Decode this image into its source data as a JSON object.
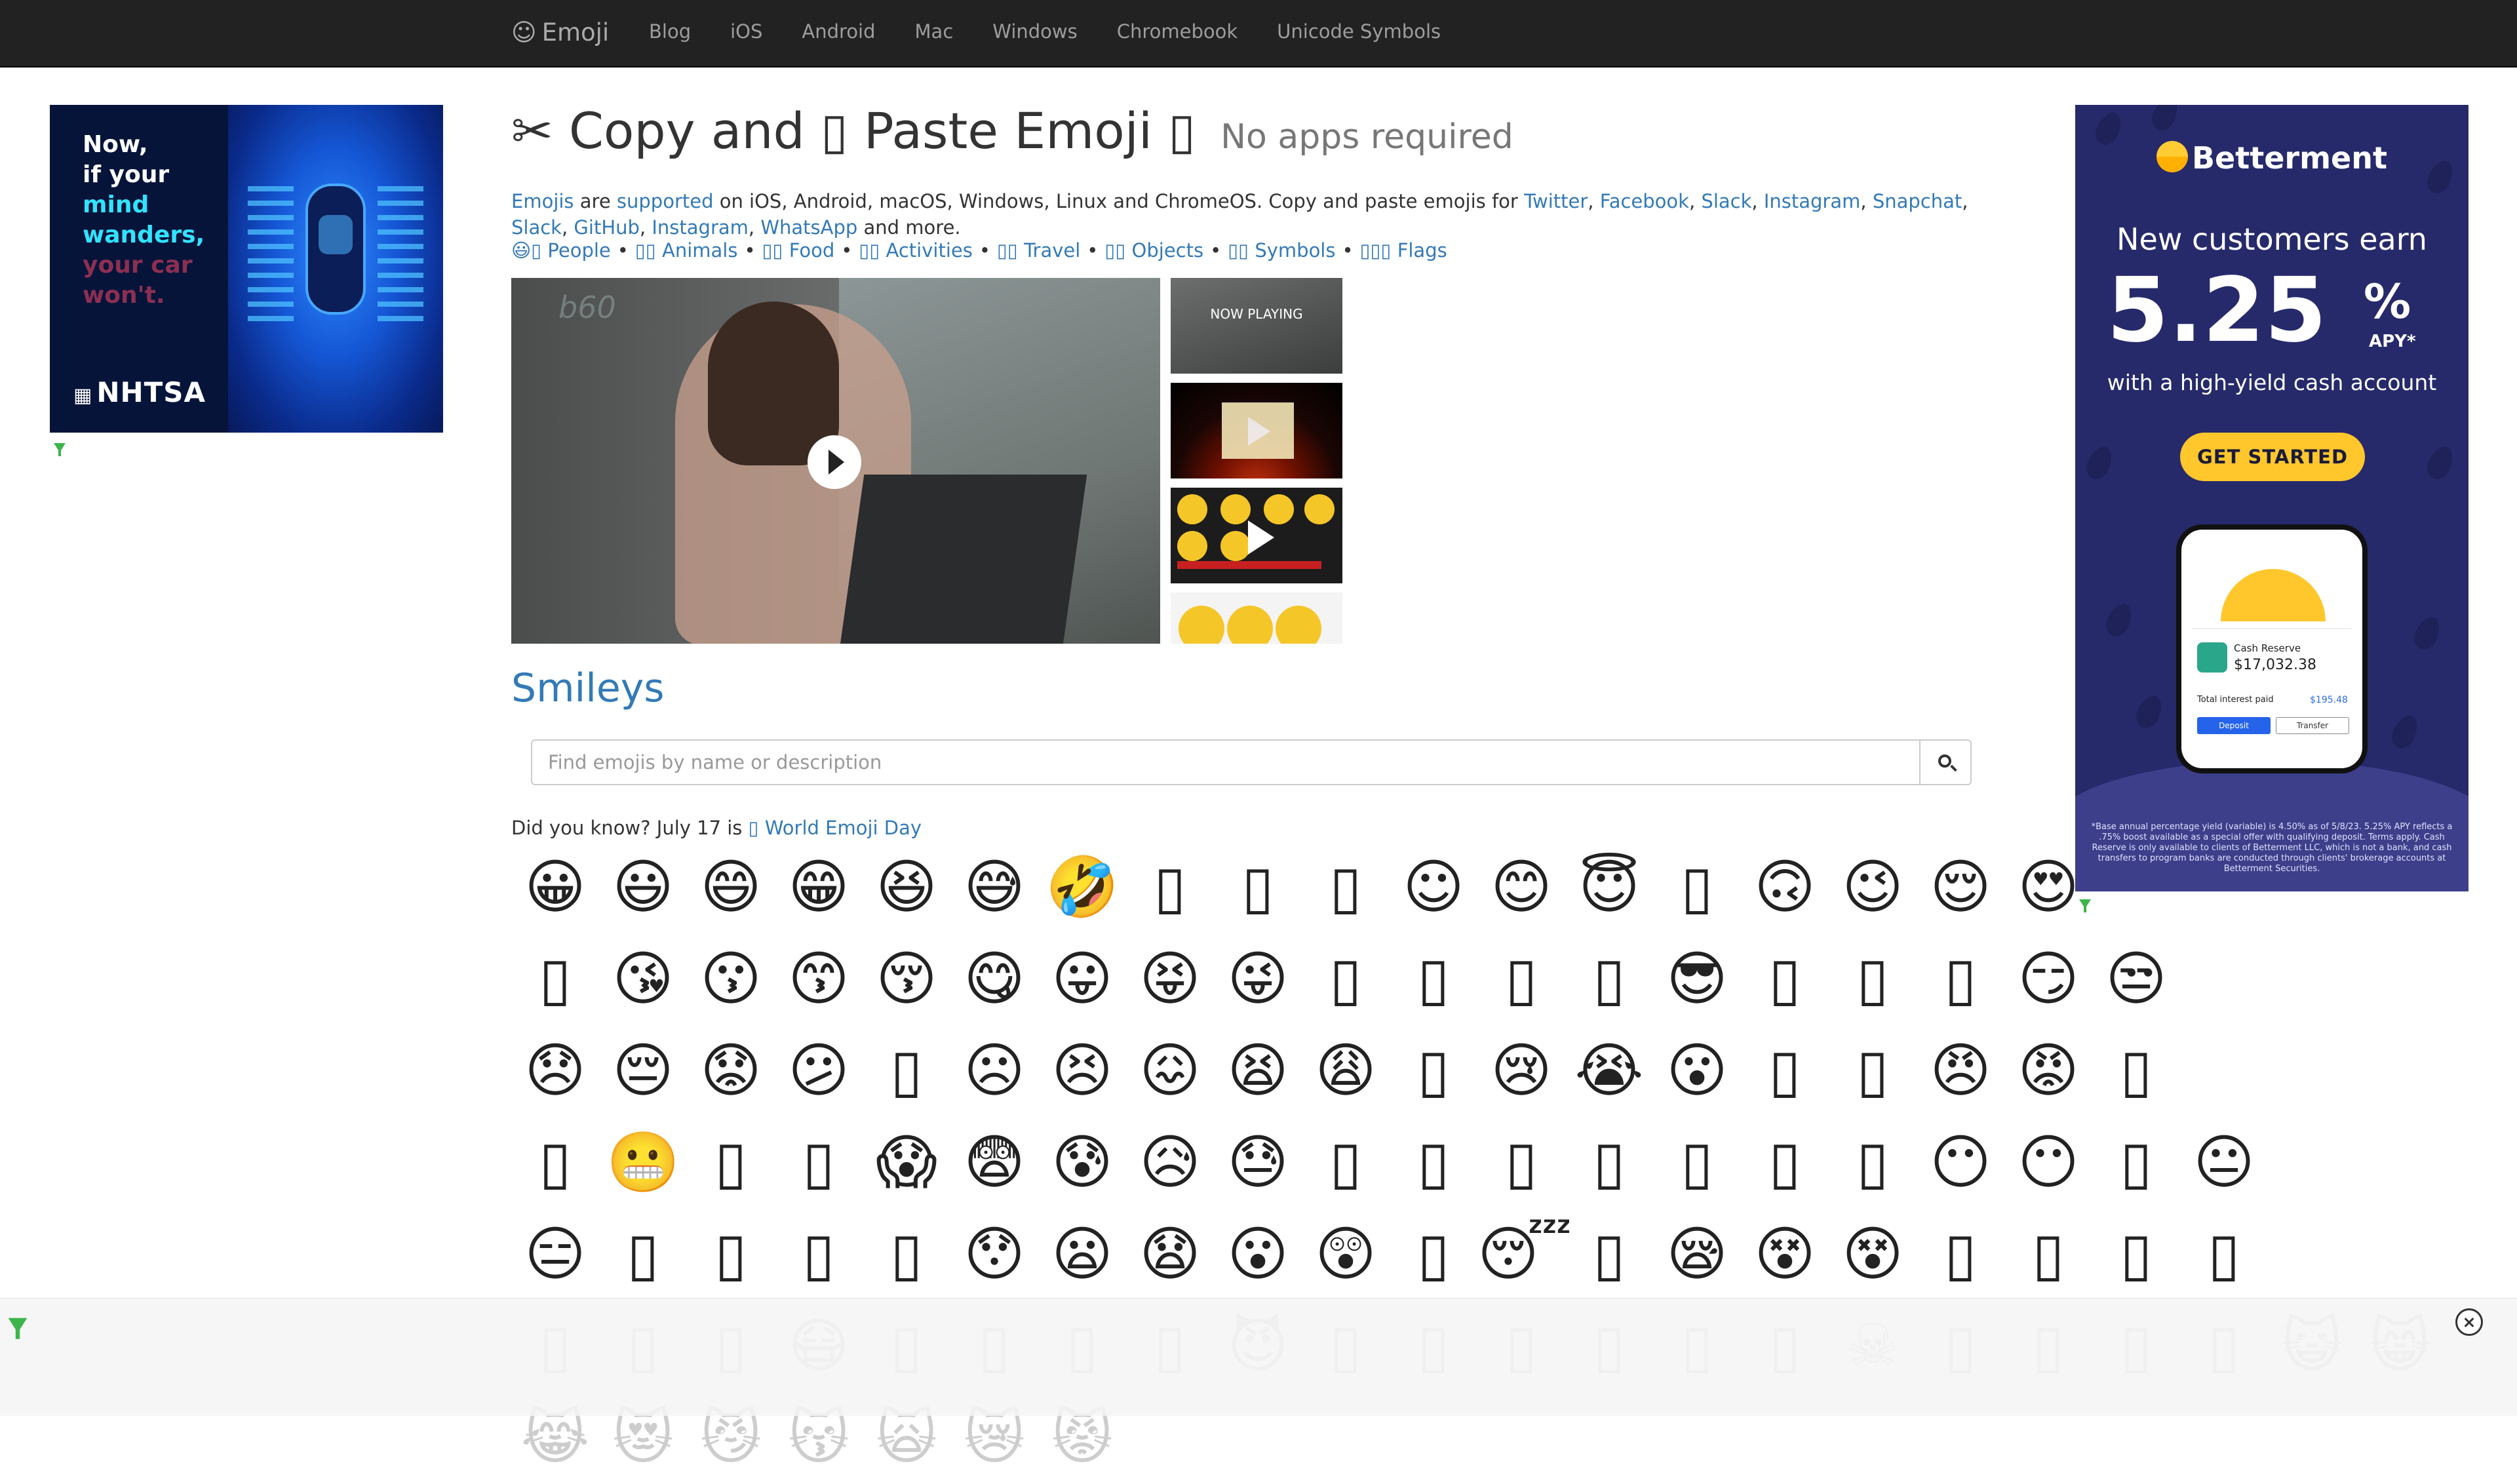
{
  "navbar": {
    "brand_symbol": "☺",
    "brand": "Emoji",
    "items": [
      "Blog",
      "iOS",
      "Android",
      "Mac",
      "Windows",
      "Chromebook",
      "Unicode Symbols"
    ]
  },
  "ad_left": {
    "line1": "Now,",
    "line2": "if your",
    "line3": "mind",
    "line4": "wanders,",
    "line5": "your car",
    "line6": "won't.",
    "logo": "NHTSA"
  },
  "ad_right": {
    "brand": "Betterment",
    "headline": "New customers earn",
    "rate": "5.25",
    "percent": "%",
    "apy": "APY*",
    "subline": "with a high-yield cash account",
    "cta": "GET STARTED",
    "card_label": "Cash Reserve",
    "card_amount": "$17,032.38",
    "interest_label": "Total interest paid",
    "interest_value": "$195.48",
    "deposit": "Deposit",
    "transfer": "Transfer",
    "fine_print": "*Base annual percentage yield (variable) is 4.50% as of 5/8/23. 5.25% APY reflects a .75% boost available as a special offer with qualifying deposit. Terms apply. Cash Reserve is only available to clients of Betterment LLC, which is not a bank, and cash transfers to program banks are conducted through clients' brokerage accounts at Betterment Securities."
  },
  "header": {
    "title_prefix": "✂ Copy and ▯ Paste Emoji ▯",
    "title_small": "No apps required"
  },
  "intro": {
    "emojis": "Emojis",
    "are": " are ",
    "supported": "supported",
    "text1": " on iOS, Android, macOS, Windows, Linux and ChromeOS. Copy and paste emojis for ",
    "twitter": "Twitter",
    "facebook": "Facebook",
    "slack": "Slack",
    "instagram": "Instagram",
    "snapchat": "Snapchat",
    "slack2": "Slack",
    "github": "GitHub",
    "instagram2": "Instagram",
    "whatsapp": "WhatsApp",
    "text2": " and more.",
    "comma": ", "
  },
  "categories": [
    "😃▯ People",
    "▯▯ Animals",
    "▯▯ Food",
    "▯▯ Activities",
    "▯▯ Travel",
    "▯▯ Objects",
    "▯▯ Symbols",
    "▯▯▯ Flags"
  ],
  "category_separator": "•",
  "video": {
    "watermark": "b60",
    "now_playing": "NOW PLAYING"
  },
  "section": {
    "title": "Smileys"
  },
  "search": {
    "placeholder": "Find emojis by name or description"
  },
  "did_you_know": {
    "prefix": "Did you know? July 17 is ",
    "link": "▯ World Emoji Day"
  },
  "emoji_rows": [
    [
      "😀",
      "😃",
      "😄",
      "😁",
      "😆",
      "😅",
      "🤣",
      "▯",
      "▯",
      "▯",
      "☺",
      "😊",
      "😇",
      "▯",
      "🙃",
      "😉",
      "😌",
      "😍"
    ],
    [
      "▯",
      "😘",
      "😗",
      "😙",
      "😚",
      "😋",
      "😛",
      "😝",
      "😜",
      "▯",
      "▯",
      "▯",
      "▯",
      "😎",
      "▯",
      "▯",
      "▯",
      "😏",
      "😒"
    ],
    [
      "😞",
      "😔",
      "😟",
      "😕",
      "▯",
      "☹",
      "😣",
      "😖",
      "😫",
      "😩",
      "▯",
      "😢",
      "😭",
      "😮",
      "▯",
      "▯",
      "😠",
      "😡",
      "▯"
    ],
    [
      "▯",
      "😬",
      "▯",
      "▯",
      "😱",
      "😨",
      "😰",
      "😥",
      "😓",
      "▯",
      "▯",
      "▯",
      "▯",
      "▯",
      "▯",
      "▯",
      "😶",
      "😶",
      "▯",
      "😐"
    ],
    [
      "😑",
      "▯",
      "▯",
      "▯",
      "▯",
      "😯",
      "😦",
      "😧",
      "😮",
      "😲",
      "▯",
      "😴",
      "▯",
      "😪",
      "😵",
      "😵",
      "▯",
      "▯",
      "▯",
      "▯"
    ],
    [
      "▯",
      "▯",
      "▯",
      "😷",
      "▯",
      "▯",
      "▯",
      "▯",
      "😈",
      "▯",
      "▯",
      "▯",
      "▯",
      "▯",
      "▯",
      "☠",
      "▯",
      "▯",
      "▯",
      "▯",
      "😺",
      "😸"
    ],
    [
      "😹",
      "😻",
      "😼",
      "😽",
      "🙀",
      "😿",
      "😾"
    ]
  ],
  "colors": {
    "navbar_bg": "#222222",
    "link": "#337ab7",
    "text": "#333333"
  }
}
